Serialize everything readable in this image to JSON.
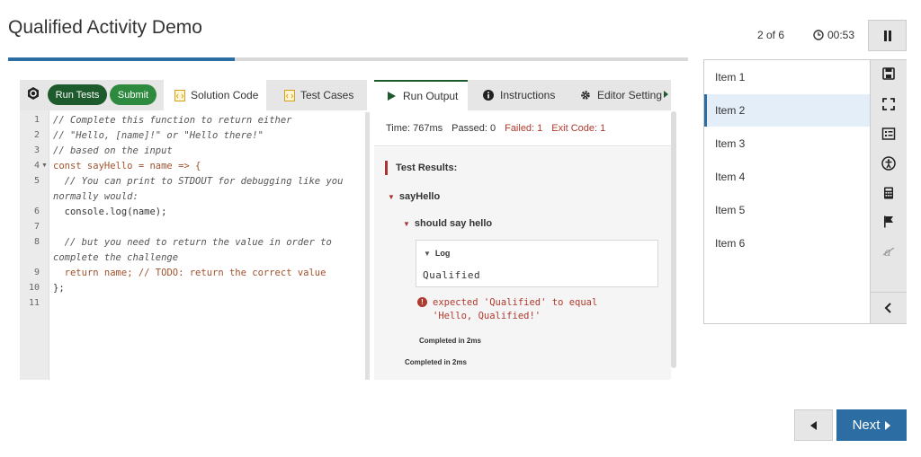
{
  "header": {
    "title": "Qualified Activity Demo",
    "counter": "2 of 6",
    "timer": "00:53",
    "progress": 0.333
  },
  "editor": {
    "run_label": "Run Tests",
    "submit_label": "Submit",
    "tabs": [
      "Solution Code",
      "Test Cases"
    ],
    "lines": [
      {
        "n": "1",
        "text": "// Complete this function to return either"
      },
      {
        "n": "2",
        "text": "// \"Hello, [name]!\" or \"Hello there!\""
      },
      {
        "n": "3",
        "text": "// based on the input"
      },
      {
        "n": "4",
        "text": "const sayHello = name => {"
      },
      {
        "n": "5",
        "text": "  // You can print to STDOUT for debugging like you normally would:"
      },
      {
        "n": "6",
        "text": "  console.log(name);"
      },
      {
        "n": "7",
        "text": ""
      },
      {
        "n": "8",
        "text": "  // but you need to return the value in order to complete the challenge"
      },
      {
        "n": "9",
        "text": "  return name; // TODO: return the correct value"
      },
      {
        "n": "10",
        "text": "};"
      },
      {
        "n": "11",
        "text": ""
      }
    ]
  },
  "output": {
    "tabs": [
      "Run Output",
      "Instructions",
      "Editor Setting"
    ],
    "time": "Time: 767ms",
    "passed": "Passed: 0",
    "failed": "Failed: 1",
    "exit": "Exit Code: 1",
    "results_title": "Test Results:",
    "describe": "sayHello",
    "it": "should say hello",
    "log_label": "Log",
    "log_text": "Qualified",
    "error_line1": "expected 'Qualified' to equal",
    "error_line2": "'Hello, Qualified!'",
    "completed_inner": "Completed in 2ms",
    "completed_outer": "Completed in 2ms"
  },
  "items": [
    "Item 1",
    "Item 2",
    "Item 3",
    "Item 4",
    "Item 5",
    "Item 6"
  ],
  "nav": {
    "next_label": "Next"
  },
  "colors": {
    "accent": "#2c6ea3",
    "run_btn": "#1d5a2c",
    "submit_btn": "#2d8a3e",
    "fail": "#b03a2e"
  }
}
